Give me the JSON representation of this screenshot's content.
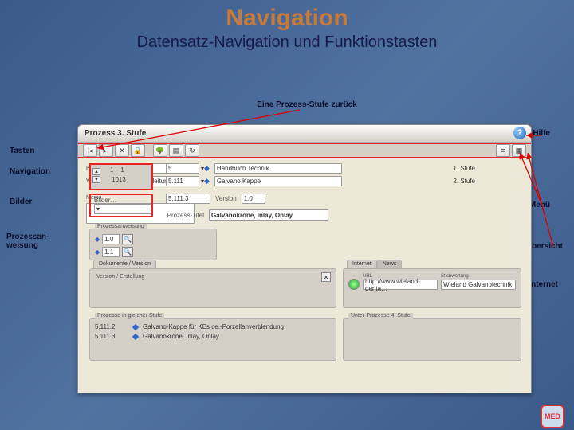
{
  "slide": {
    "title": "Navigation",
    "subtitle": "Datensatz-Navigation und Funktionstasten"
  },
  "captions": {
    "back_step": "Eine Prozess-Stufe zurück",
    "tasten": "Tasten",
    "navigation": "Navigation",
    "bilder": "Bilder",
    "prozessanweisung": "Prozessan-\nweisung",
    "hilfe": "Hilfe",
    "menu": "Menü",
    "uebersicht": "Übersicht",
    "internet": "Internet"
  },
  "window": {
    "title": "Prozess 3. Stufe",
    "help_glyph": "?",
    "record": {
      "pos": "1 – 1",
      "id": "1013"
    },
    "row1": {
      "num": "5",
      "diamond": "◆",
      "text": "Handbuch Technik",
      "stufe": "1. Stufe"
    },
    "row2": {
      "num": "5.111",
      "diamond": "◆",
      "text": "Galvano Kappe",
      "stufe": "2. Stufe"
    },
    "bilder_sel": "Bilder…",
    "row3": {
      "num": "5.111.3",
      "ver_label": "Version",
      "ver": "1.0"
    },
    "proc_title_label": "Prozess-Titel",
    "proc_title": "Galvanokrone, Inlay, Onlay",
    "pa": {
      "title": "Prozessanweisung",
      "v1": "1.0",
      "v2": "1.1",
      "search_glyph": "🔍"
    },
    "mid": {
      "prozess_label": "Prozessart",
      "prozess_val": "",
      "verant_label": "Verantwortlich",
      "verant_val": "Laborleitung"
    },
    "memo": {
      "label": "Memo"
    },
    "dv": {
      "tab": "Dokumente / Version",
      "inner": "Version / Erstellung",
      "x": "✕"
    },
    "internet": {
      "tab1": "Internet",
      "tab2": "News",
      "url_label": "URL",
      "url": "http://www.wieland-denta…",
      "stich_label": "Stichwortung",
      "stich": "Wieland Galvanotechnik"
    },
    "pg": {
      "title": "Prozesse in gleicher Stufe",
      "items": [
        {
          "code": "5.111.2",
          "text": "Galvano-Kappe für KEs ce.-Porzellanverblendung"
        },
        {
          "code": "5.111.3",
          "text": "Galvanokrone, Inlay, Onlay"
        }
      ]
    },
    "up": {
      "title": "Unter-Prozesse 4. Stufe"
    }
  },
  "logo": "MED"
}
